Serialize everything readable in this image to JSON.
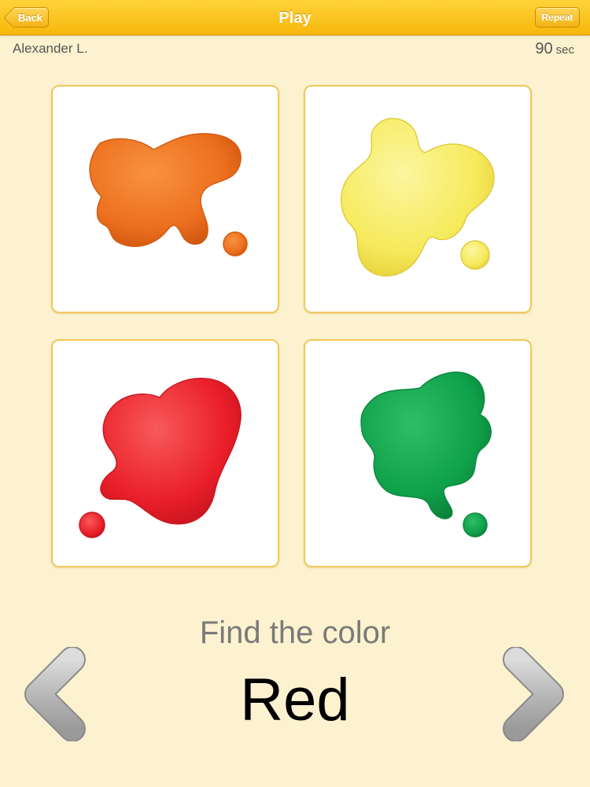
{
  "header": {
    "title": "Play",
    "back_label": "Back",
    "repeat_label": "Repeat"
  },
  "player": {
    "name": "Alexander L."
  },
  "timer": {
    "value": "90",
    "unit": "sec"
  },
  "cards": [
    {
      "color_name": "orange",
      "color": "#ec6f1e"
    },
    {
      "color_name": "yellow",
      "color": "#f6ea5c"
    },
    {
      "color_name": "red",
      "color": "#ea1f2a"
    },
    {
      "color_name": "green",
      "color": "#0fa04a"
    }
  ],
  "prompt": {
    "instruction": "Find the color",
    "target_color": "Red"
  },
  "icons": {
    "previous": "chevron-left-icon",
    "next": "chevron-right-icon"
  }
}
